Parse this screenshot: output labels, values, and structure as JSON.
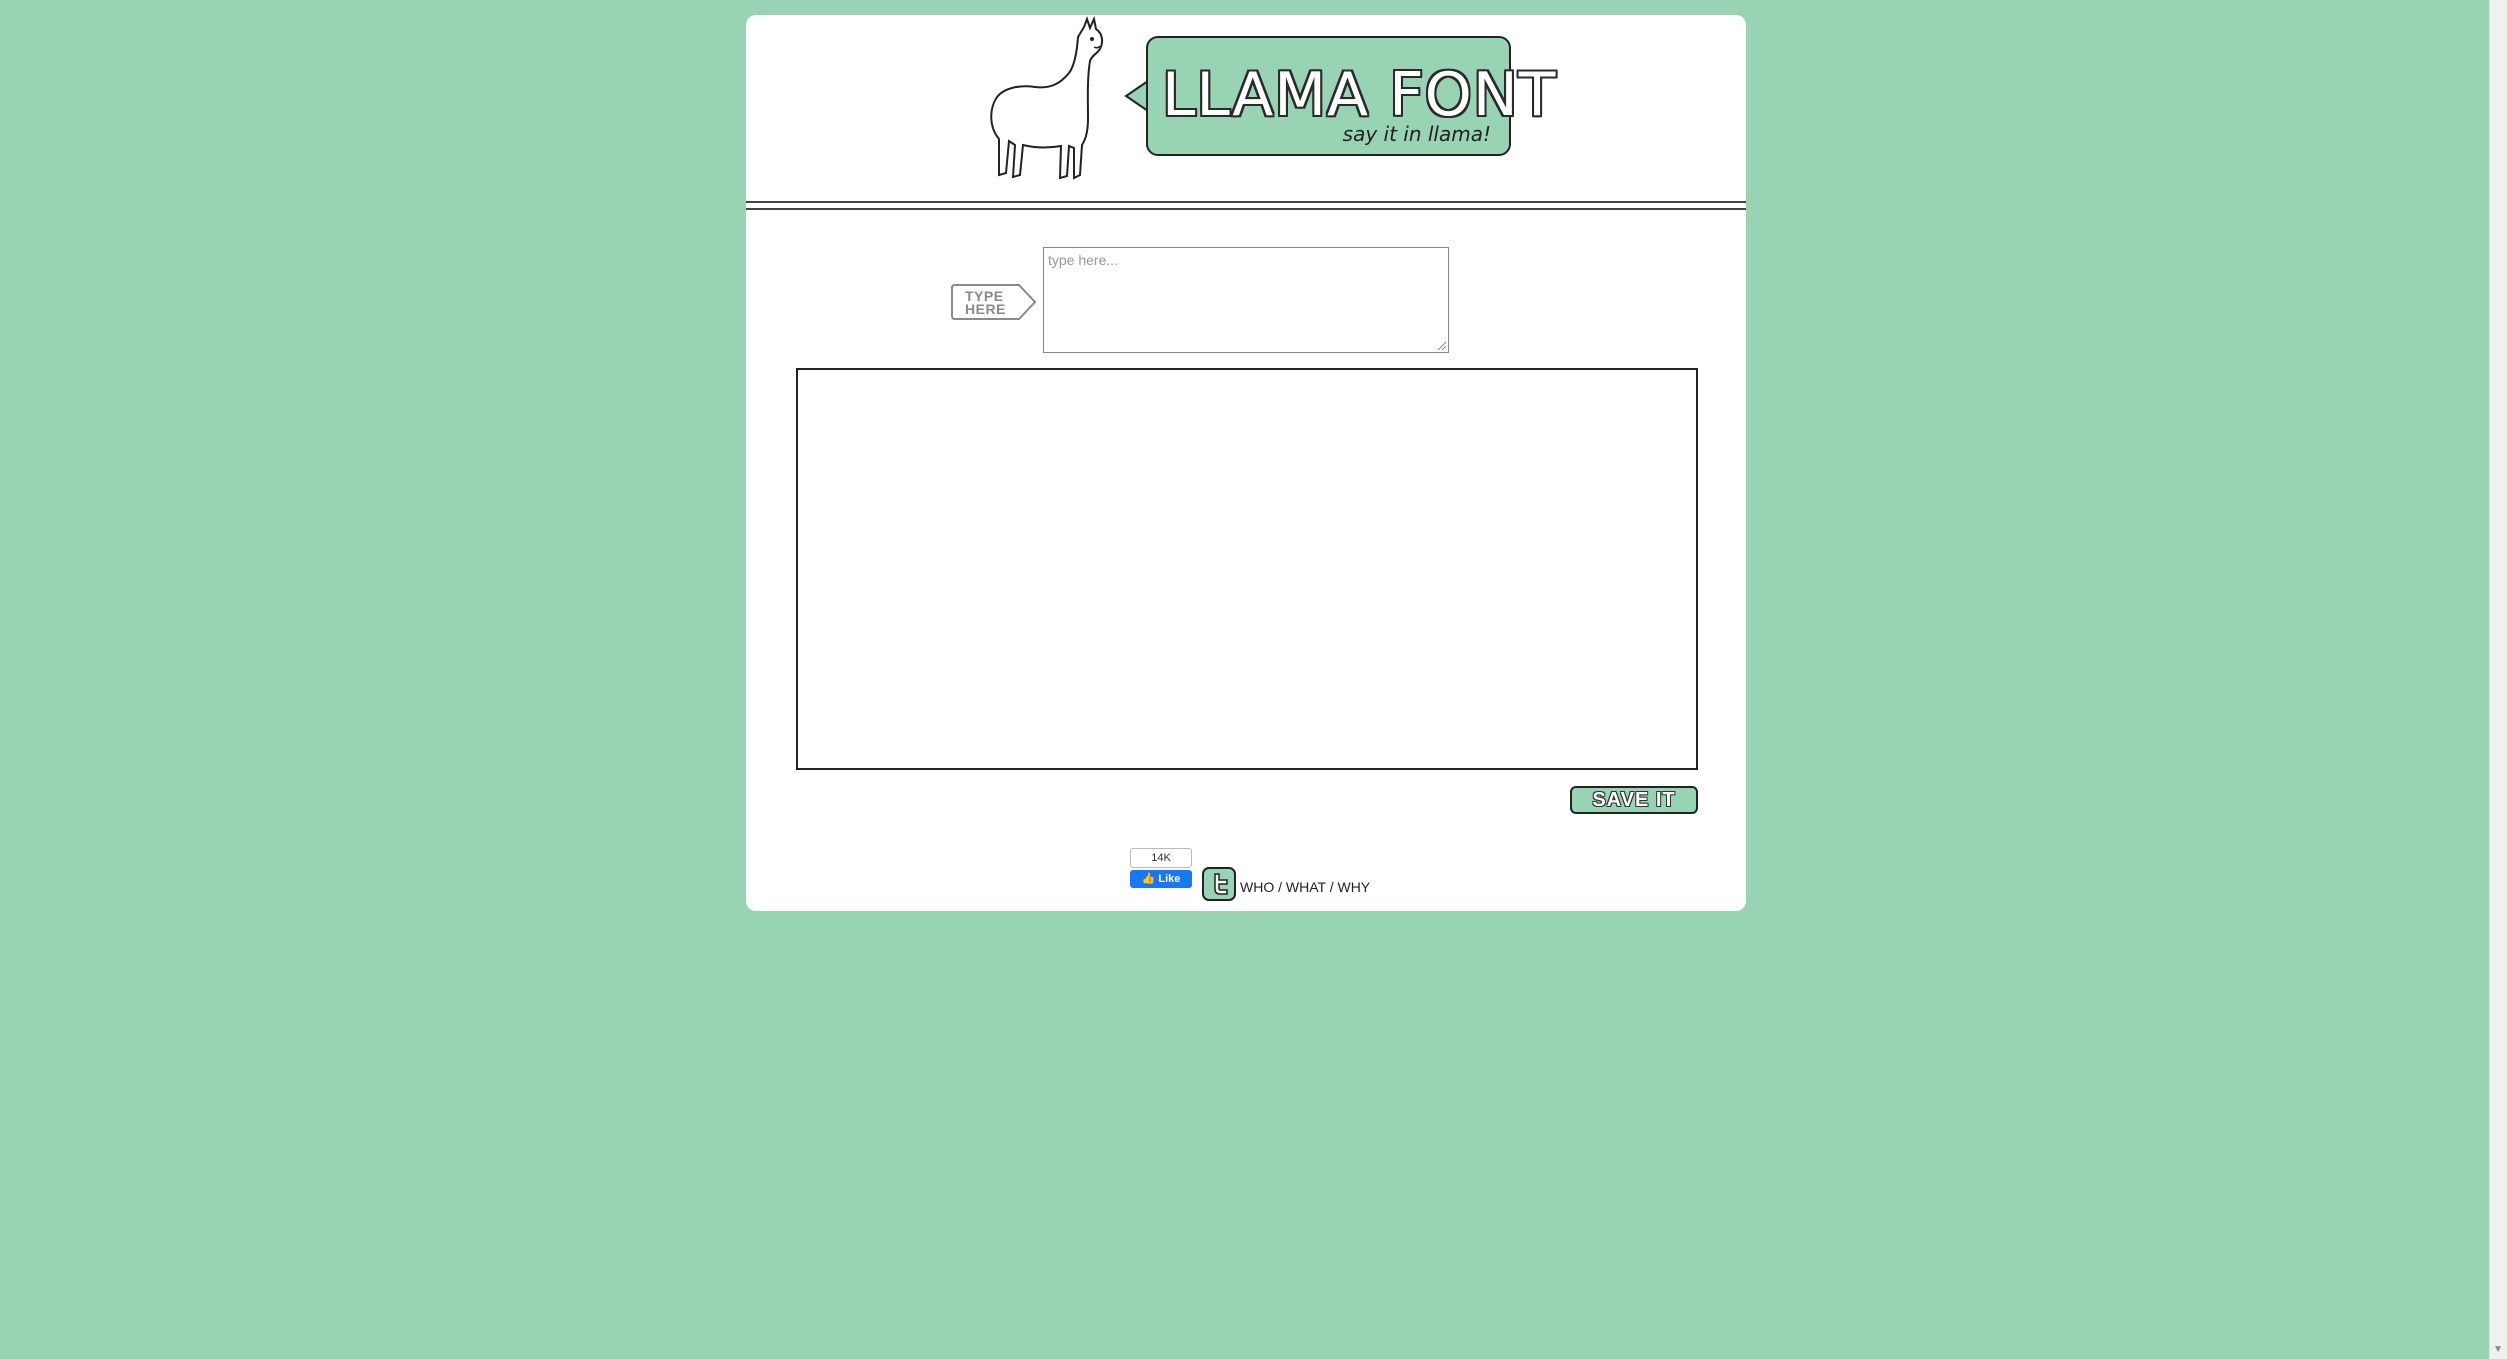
{
  "header": {
    "logo_title": "LLAMA FONT",
    "logo_tagline": "say it in llama!"
  },
  "input": {
    "label_line1": "TYPE",
    "label_line2": "HERE",
    "placeholder": "type here...",
    "value": ""
  },
  "actions": {
    "save_label": "SAVE IT"
  },
  "social": {
    "like_count": "14K",
    "like_label": "Like"
  },
  "footer": {
    "link_who": "WHO",
    "link_what": "WHAT",
    "link_why": "WHY",
    "separator": "/"
  },
  "colors": {
    "background": "#98d3b3",
    "panel": "#ffffff",
    "accent": "#98d3b3",
    "facebook": "#1877f2"
  }
}
